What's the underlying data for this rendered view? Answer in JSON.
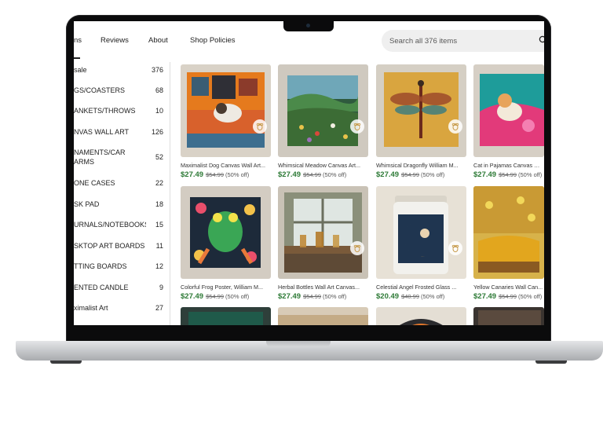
{
  "nav": {
    "tab_cut_label": "ns",
    "links": [
      "Reviews",
      "About",
      "Shop Policies"
    ]
  },
  "search": {
    "placeholder": "Search all 376 items"
  },
  "sidebar": {
    "items": [
      {
        "label": "sale",
        "count": "376"
      },
      {
        "label": "GS/COASTERS",
        "count": "68"
      },
      {
        "label": "ANKETS/THROWS",
        "count": "10"
      },
      {
        "label": "NVAS WALL ART",
        "count": "126"
      },
      {
        "label": "NAMENTS/CAR ARMS",
        "count": "52"
      },
      {
        "label": "ONE CASES",
        "count": "22"
      },
      {
        "label": "SK PAD",
        "count": "18"
      },
      {
        "label": "URNALS/NOTEBOOKS",
        "count": "15"
      },
      {
        "label": "SKTOP ART BOARDS",
        "count": "11"
      },
      {
        "label": "TTING BOARDS",
        "count": "12"
      },
      {
        "label": "ENTED CANDLE",
        "count": "9"
      },
      {
        "label": "ximalist Art",
        "count": "27"
      }
    ]
  },
  "products": [
    {
      "title": "Maximalist Dog Canvas Wall Art...",
      "price": "$27.49",
      "original": "$54.99",
      "discount": "(50% off)"
    },
    {
      "title": "Whimsical Meadow Canvas Art...",
      "price": "$27.49",
      "original": "$54.99",
      "discount": "(50% off)"
    },
    {
      "title": "Whimsical Dragonfly William M...",
      "price": "$27.49",
      "original": "$54.99",
      "discount": "(50% off)"
    },
    {
      "title": "Cat in Pajamas Canvas Wa...",
      "price": "$27.49",
      "original": "$54.99",
      "discount": "(50% off)"
    },
    {
      "title": "Colorful Frog Poster, William M...",
      "price": "$27.49",
      "original": "$54.99",
      "discount": "(50% off)"
    },
    {
      "title": "Herbal Bottles Wall Art Canvas...",
      "price": "$27.49",
      "original": "$54.99",
      "discount": "(50% off)"
    },
    {
      "title": "Celestial Angel Frosted Glass ...",
      "price": "$20.49",
      "original": "$40.99",
      "discount": "(50% off)"
    },
    {
      "title": "Yellow Canaries Wall Can...",
      "price": "$27.49",
      "original": "$54.99",
      "discount": "(50% off)"
    }
  ],
  "colors": {
    "price_green": "#2d7a36",
    "search_bg": "#efefef",
    "bezel": "#0b0b0c"
  }
}
